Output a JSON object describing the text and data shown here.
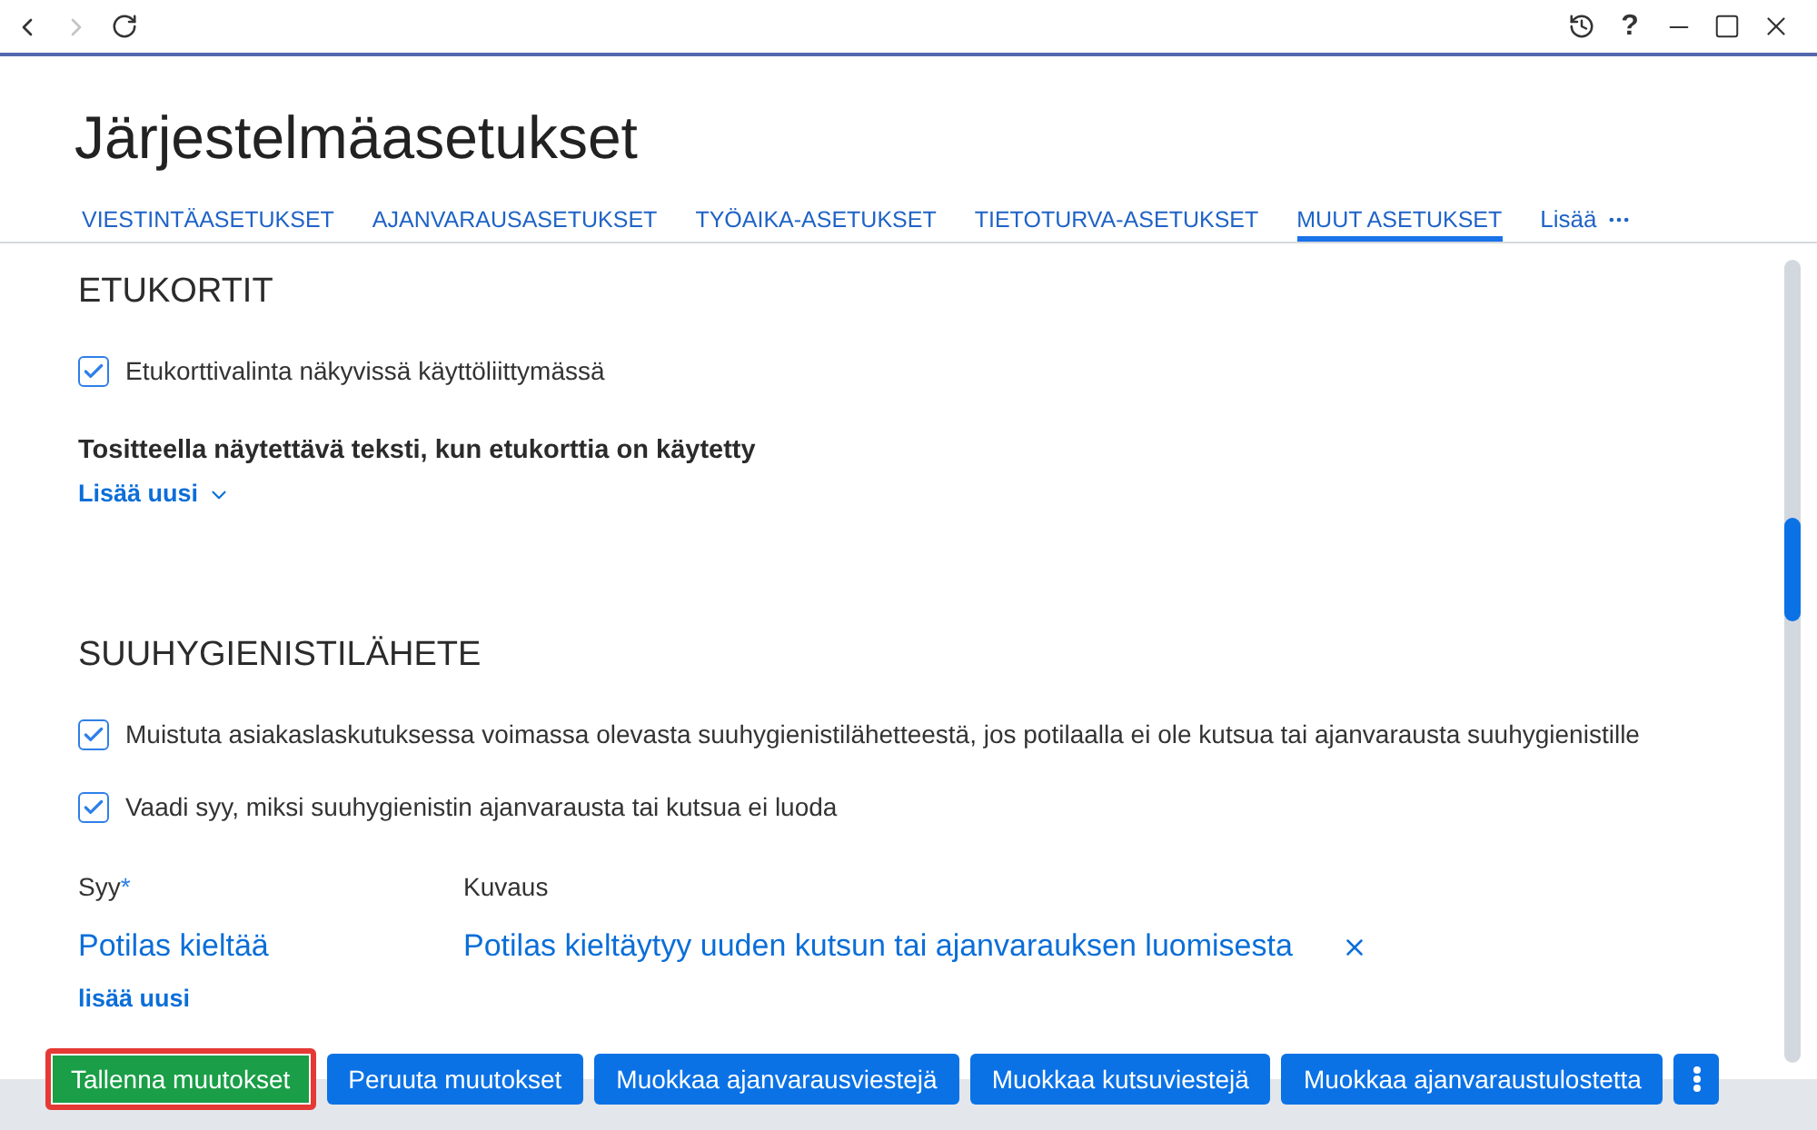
{
  "window": {
    "back": {
      "disabled": false
    },
    "forward": {
      "disabled": true
    },
    "help_label": "?"
  },
  "page": {
    "title": "Järjestelmäasetukset"
  },
  "tabs": [
    {
      "label": "VIESTINTÄASETUKSET",
      "selected": false
    },
    {
      "label": "AJANVARAUSASETUKSET",
      "selected": false
    },
    {
      "label": "TYÖAIKA-ASETUKSET",
      "selected": false
    },
    {
      "label": "TIETOTURVA-ASETUKSET",
      "selected": false
    },
    {
      "label": "MUUT ASETUKSET",
      "selected": true
    }
  ],
  "more_tab": {
    "label": "Lisää"
  },
  "sections": [
    {
      "title": "ETUKORTIT",
      "items": [
        {
          "kind": "checkbox",
          "label": "Etukorttivalinta näkyvissä käyttöliittymässä",
          "checked": true
        },
        {
          "kind": "subheading",
          "label": "Tositteella näytettävä teksti, kun etukorttia on käytetty"
        },
        {
          "kind": "add_menu",
          "label": "Lisää uusi"
        }
      ]
    },
    {
      "title": "SUUHYGIENISTILÄHETE",
      "items": [
        {
          "kind": "checkbox",
          "label": "Muistuta asiakaslaskutuksessa voimassa olevasta suuhygienistilähetteestä, jos potilaalla ei ole kutsua tai ajanvarausta suuhygienistille",
          "checked": true
        },
        {
          "kind": "checkbox",
          "label": "Vaadi syy, miksi suuhygienistin ajanvarausta tai kutsua ei luoda",
          "checked": true
        },
        {
          "kind": "reason_table",
          "columns": [
            {
              "label": "Syy",
              "required_mark": "*"
            },
            {
              "label": "Kuvaus"
            }
          ],
          "rows": [
            {
              "reason": "Potilas kieltää",
              "description": "Potilas kieltäytyy uuden kutsun tai ajanvarauksen luomisesta"
            }
          ],
          "add_label": "lisää uusi"
        }
      ]
    }
  ],
  "buttons": [
    {
      "kind": "success",
      "label": "Tallenna muutokset",
      "highlighted": true
    },
    {
      "kind": "primary",
      "label": "Peruuta muutokset",
      "highlighted": false
    },
    {
      "kind": "primary",
      "label": "Muokkaa ajanvarausviestejä",
      "highlighted": false
    },
    {
      "kind": "primary",
      "label": "Muokkaa kutsuviestejä",
      "highlighted": false
    },
    {
      "kind": "primary",
      "label": "Muokkaa ajanvaraustulostetta",
      "highlighted": false
    },
    {
      "kind": "menu",
      "highlighted": false
    }
  ]
}
